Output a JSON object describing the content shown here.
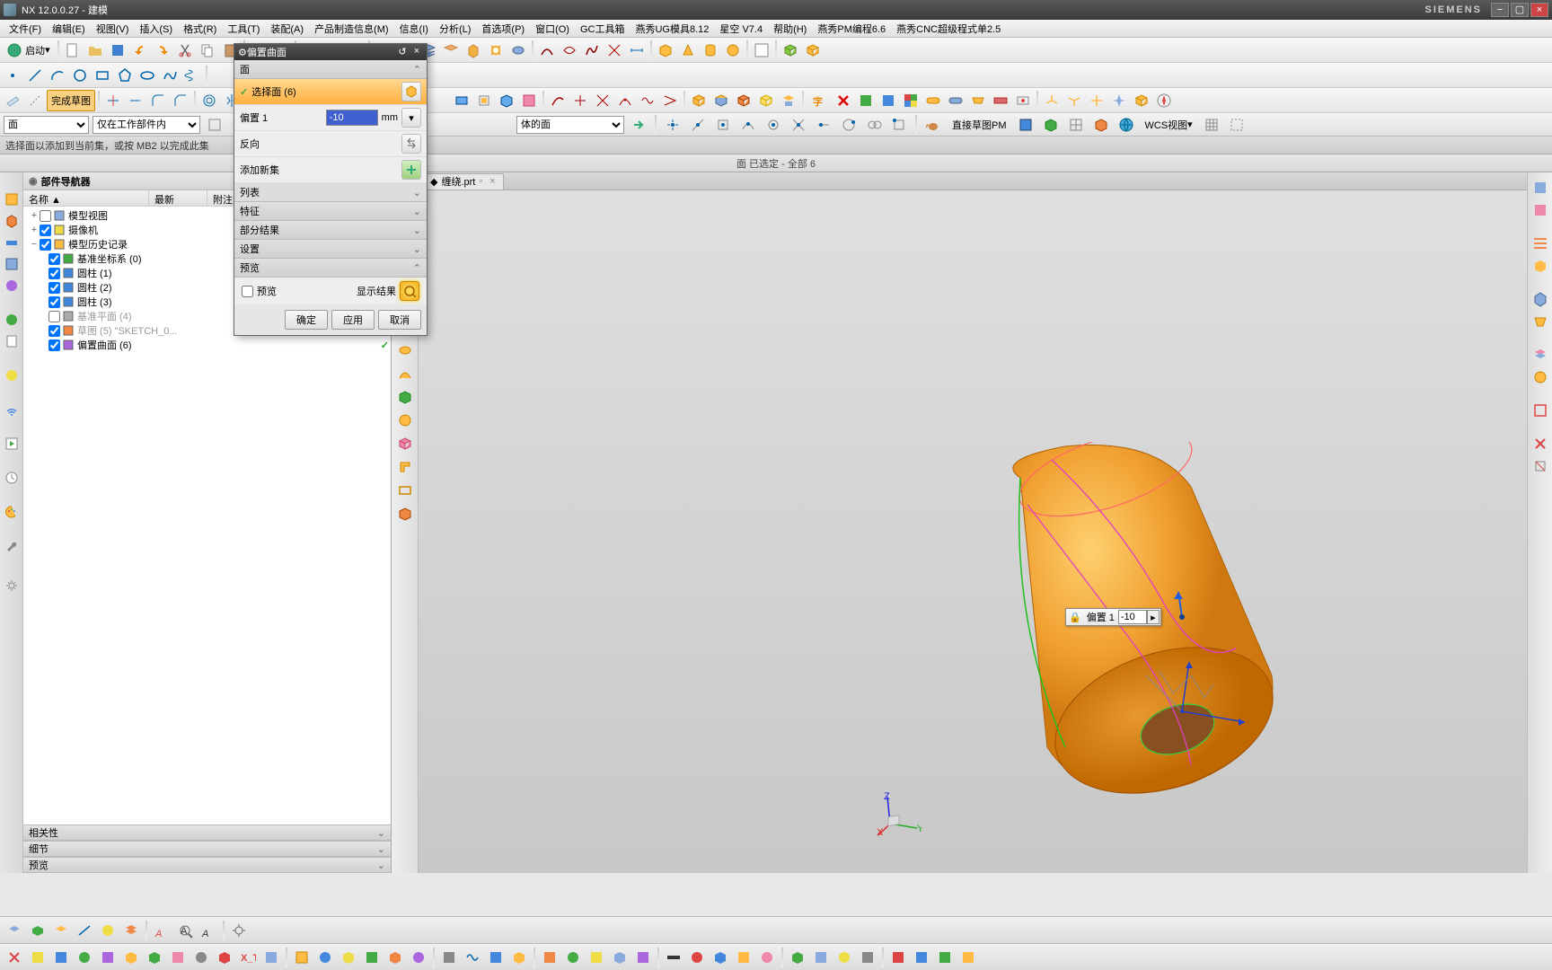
{
  "title": "NX 12.0.0.27 - 建模",
  "brand": "SIEMENS",
  "menu": [
    "文件(F)",
    "编辑(E)",
    "视图(V)",
    "插入(S)",
    "格式(R)",
    "工具(T)",
    "装配(A)",
    "产品制造信息(M)",
    "信息(I)",
    "分析(L)",
    "首选项(P)",
    "窗口(O)",
    "GC工具箱",
    "燕秀UG模具8.12",
    "星空 V7.4",
    "帮助(H)",
    "燕秀PM编程6.6",
    "燕秀CNC超级程式单2.5"
  ],
  "start_label": "启动",
  "selection_filter": "面",
  "scope_filter": "仅在工作部件内",
  "body_filter": "体的面",
  "wcs_label": "WCS视图",
  "direct_label": "直接草图PM",
  "prompt": "选择面以添加到当前集，或按 MB2 以完成此集",
  "status": "面 已选定 - 全部 6",
  "nav": {
    "title": "部件导航器",
    "cols": [
      "名称 ▲",
      "最新",
      "附注"
    ],
    "items": [
      {
        "ind": 0,
        "exp": "+",
        "ico": "grp",
        "label": "模型视图",
        "chk": false,
        "tick": false
      },
      {
        "ind": 0,
        "exp": "+",
        "ico": "cam",
        "label": "摄像机",
        "chk": true,
        "tick": false
      },
      {
        "ind": 0,
        "exp": "−",
        "ico": "fldr",
        "label": "模型历史记录",
        "chk": true,
        "tick": false
      },
      {
        "ind": 1,
        "exp": "",
        "ico": "csys",
        "label": "基准坐标系 (0)",
        "chk": true,
        "tick": true
      },
      {
        "ind": 1,
        "exp": "",
        "ico": "cyl",
        "label": "圆柱 (1)",
        "chk": true,
        "tick": true
      },
      {
        "ind": 1,
        "exp": "",
        "ico": "cyl",
        "label": "圆柱 (2)",
        "chk": true,
        "tick": true
      },
      {
        "ind": 1,
        "exp": "",
        "ico": "cyl",
        "label": "圆柱 (3)",
        "chk": true,
        "tick": true
      },
      {
        "ind": 1,
        "exp": "",
        "ico": "pln",
        "label": "基准平面 (4)",
        "chk": false,
        "tick": true,
        "dim": true
      },
      {
        "ind": 1,
        "exp": "",
        "ico": "skt",
        "label": "草图 (5) \"SKETCH_0...",
        "chk": true,
        "tick": true,
        "dim": true
      },
      {
        "ind": 1,
        "exp": "",
        "ico": "off",
        "label": "偏置曲面 (6)",
        "chk": true,
        "tick": true
      }
    ],
    "sections": [
      "相关性",
      "细节",
      "预览"
    ]
  },
  "tab_name": "缠绕.prt",
  "dialog": {
    "title": "偏置曲面",
    "sec_face": "面",
    "select_face": "选择面 (6)",
    "offset_label": "偏置 1",
    "offset_value": "-10",
    "offset_unit": "mm",
    "reverse": "反向",
    "add_set": "添加新集",
    "list": "列表",
    "feature": "特征",
    "partial": "部分结果",
    "settings": "设置",
    "preview_sec": "预览",
    "preview_chk": "预览",
    "show_result": "显示结果",
    "ok": "确定",
    "apply": "应用",
    "cancel": "取消"
  },
  "float": {
    "label": "偏置 1",
    "value": "-10"
  }
}
